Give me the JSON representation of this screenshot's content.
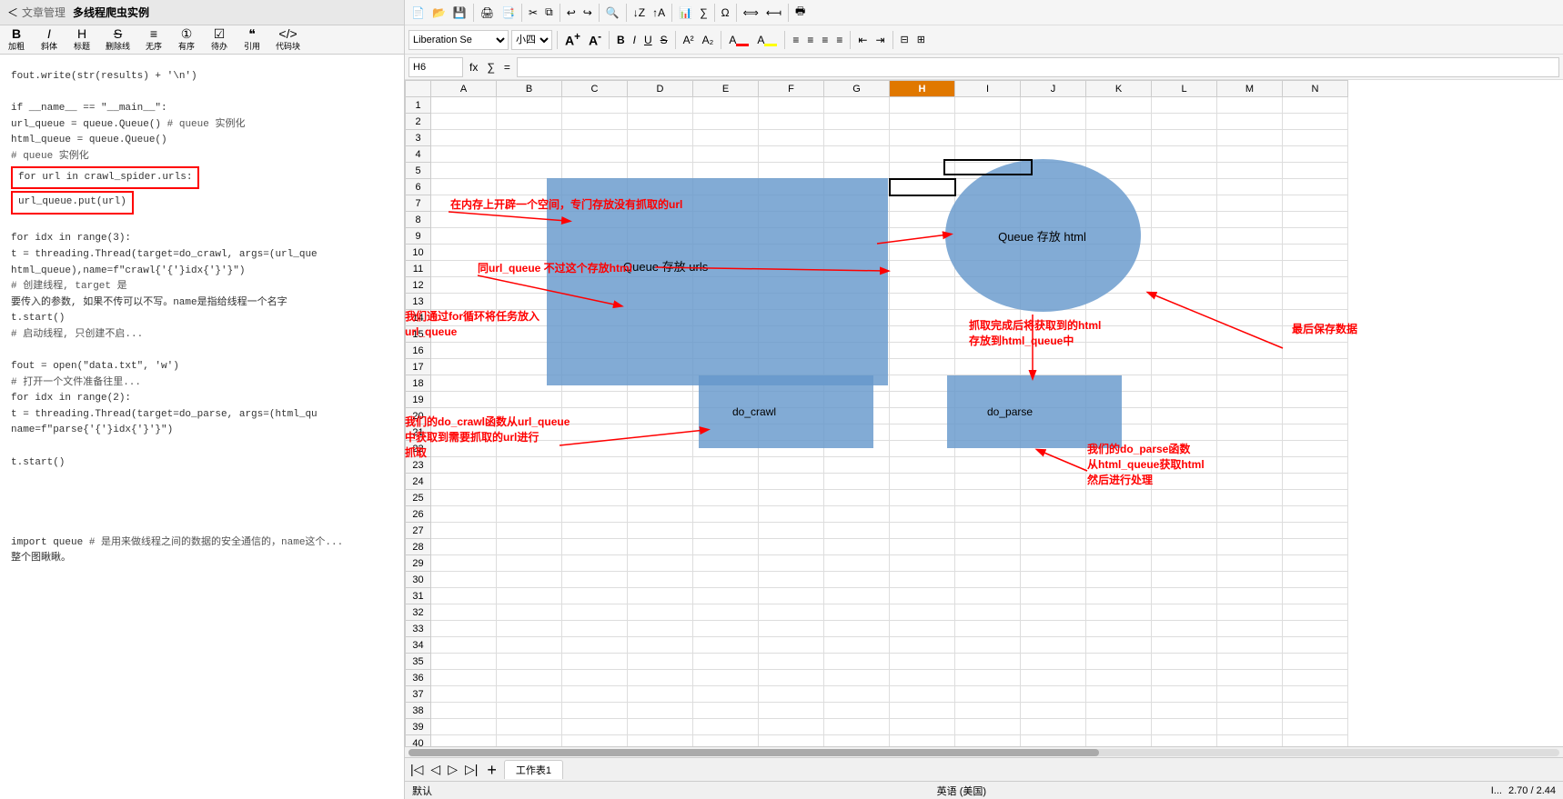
{
  "breadcrumb": {
    "back_label": "文章管理",
    "current_label": "多线程爬虫实例"
  },
  "editor_toolbar": {
    "buttons": [
      "加粗",
      "斜体",
      "标题",
      "删除线",
      "无序",
      "有序",
      "待办",
      "引用",
      "代码块"
    ]
  },
  "code": {
    "lines": [
      "fout.write(str(results) + '\\n')",
      "",
      "if __name__ == \"__main__\":",
      "    url_queue = queue.Queue()  # queue 实例化",
      "    html_queue = queue.Queue()",
      "    # queue 实例化",
      "    for url in crawl_spider.urls:",
      "        url_queue.put(url)",
      "",
      "    for idx in range(3):",
      "        t = threading.Thread(target=do_crawl, args=(url_que",
      "html_queue),name=f\"crawl{idx}\")",
      "        # 创建线程, target 是",
      "要传入的参数, 如果不传可以不写。name是指给线程一个名字",
      "        t.start()",
      "        # 启动线程, 只创建不启...",
      "",
      "    fout = open(\"data.txt\", 'w')",
      "        # 打开一个文件准备往里...",
      "    for idx in range(2):",
      "        t = threading.Thread(target=do_parse, args=(html_qu",
      "name=f\"parse{idx}\")",
      "",
      "        t.start()",
      "",
      "",
      "",
      "",
      "import queue # 是用来做线程之间的数据的安全通信的，name这个...",
      "整个图瞅瞅。"
    ]
  },
  "spreadsheet": {
    "font_name": "Liberation Se",
    "font_size": "小四",
    "cell_ref": "H6",
    "columns": [
      "A",
      "B",
      "C",
      "D",
      "E",
      "F",
      "G",
      "H",
      "I",
      "J",
      "K",
      "L",
      "M",
      "N"
    ],
    "active_col": "H",
    "rows": 40
  },
  "shapes": {
    "rect_url_label": "Queue 存放 urls",
    "oval_html_label": "Queue 存放 html",
    "rect_crawl_label": "do_crawl",
    "rect_parse_label": "do_parse"
  },
  "annotations": {
    "ann1": "在内存上开辟一个空间，专门存放没有抓取的url",
    "ann2": "同url_queue 不过这个存放html",
    "ann3": "我们通过for循环将任务放入\nurl_queue",
    "ann4": "我们的do_crawl函数从url_queue\n中获取到需要抓取的url进行\n抓取",
    "ann5": "抓取完成后将获取到的html\n存放到html_queue中",
    "ann6": "我们的do_parse函数\n从html_queue获取html\n然后进行处理",
    "ann7": "最后保存数据"
  },
  "sheet_tabs": {
    "tabs": [
      "工作表1"
    ],
    "active": "工作表1"
  },
  "status_bar": {
    "left": "默认",
    "middle": "英语 (美国)",
    "right_zoom": "2.70 / 2.44"
  }
}
